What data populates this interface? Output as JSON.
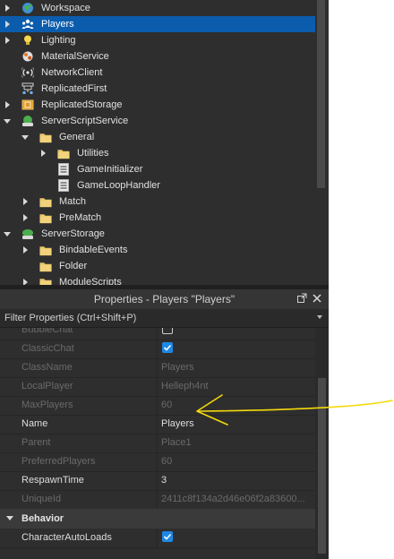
{
  "explorer": {
    "items": [
      {
        "label": "Workspace",
        "icon": "globe-icon",
        "arrow": "right",
        "depth": 0,
        "selected": false
      },
      {
        "label": "Players",
        "icon": "players-icon",
        "arrow": "right",
        "depth": 0,
        "selected": true
      },
      {
        "label": "Lighting",
        "icon": "lightbulb-icon",
        "arrow": "right",
        "depth": 0,
        "selected": false
      },
      {
        "label": "MaterialService",
        "icon": "material-service-icon",
        "arrow": "none",
        "depth": 0,
        "selected": false
      },
      {
        "label": "NetworkClient",
        "icon": "network-client-icon",
        "arrow": "none",
        "depth": 0,
        "selected": false
      },
      {
        "label": "ReplicatedFirst",
        "icon": "replicated-first-icon",
        "arrow": "none",
        "depth": 0,
        "selected": false
      },
      {
        "label": "ReplicatedStorage",
        "icon": "replicated-storage-icon",
        "arrow": "right",
        "depth": 0,
        "selected": false
      },
      {
        "label": "ServerScriptService",
        "icon": "server-script-service-icon",
        "arrow": "down",
        "depth": 0,
        "selected": false
      },
      {
        "label": "General",
        "icon": "folder-icon",
        "arrow": "down",
        "depth": 1,
        "selected": false
      },
      {
        "label": "Utilities",
        "icon": "folder-icon",
        "arrow": "right",
        "depth": 2,
        "selected": false
      },
      {
        "label": "GameInitializer",
        "icon": "script-icon",
        "arrow": "none",
        "depth": 2,
        "selected": false
      },
      {
        "label": "GameLoopHandler",
        "icon": "script-icon",
        "arrow": "none",
        "depth": 2,
        "selected": false
      },
      {
        "label": "Match",
        "icon": "folder-icon",
        "arrow": "right",
        "depth": 1,
        "selected": false
      },
      {
        "label": "PreMatch",
        "icon": "folder-icon",
        "arrow": "right",
        "depth": 1,
        "selected": false
      },
      {
        "label": "ServerStorage",
        "icon": "server-storage-icon",
        "arrow": "down",
        "depth": 0,
        "selected": false
      },
      {
        "label": "BindableEvents",
        "icon": "folder-icon",
        "arrow": "right",
        "depth": 1,
        "selected": false
      },
      {
        "label": "Folder",
        "icon": "folder-icon",
        "arrow": "none",
        "depth": 1,
        "selected": false
      },
      {
        "label": "ModuleScripts",
        "icon": "folder-icon",
        "arrow": "right",
        "depth": 1,
        "selected": false
      }
    ]
  },
  "properties": {
    "title": "Properties - Players \"Players\"",
    "filter_placeholder": "Filter Properties (Ctrl+Shift+P)",
    "rows": [
      {
        "kind": "checkbox",
        "name": "BubbleChat",
        "checked": false,
        "readonly": true
      },
      {
        "kind": "checkbox",
        "name": "ClassicChat",
        "checked": true,
        "readonly": true
      },
      {
        "kind": "text",
        "name": "ClassName",
        "value": "Players",
        "readonly": true
      },
      {
        "kind": "text",
        "name": "LocalPlayer",
        "value": "Helleph4nt",
        "readonly": true
      },
      {
        "kind": "text",
        "name": "MaxPlayers",
        "value": "60",
        "readonly": true
      },
      {
        "kind": "text",
        "name": "Name",
        "value": "Players",
        "readonly": false
      },
      {
        "kind": "text",
        "name": "Parent",
        "value": "Place1",
        "readonly": true
      },
      {
        "kind": "text",
        "name": "PreferredPlayers",
        "value": "60",
        "readonly": true
      },
      {
        "kind": "text",
        "name": "RespawnTime",
        "value": "3",
        "readonly": false
      },
      {
        "kind": "text",
        "name": "UniqueId",
        "value": "2411c8f134a2d46e06f2a83600...",
        "readonly": true
      },
      {
        "kind": "section",
        "name": "Behavior"
      },
      {
        "kind": "checkbox",
        "name": "CharacterAutoLoads",
        "checked": true,
        "readonly": false
      }
    ]
  },
  "colors": {
    "panel_bg": "#2e2e2e",
    "selection": "#0b5cad",
    "checkbox": "#1e88e5",
    "annotation": "#f5d90a"
  }
}
